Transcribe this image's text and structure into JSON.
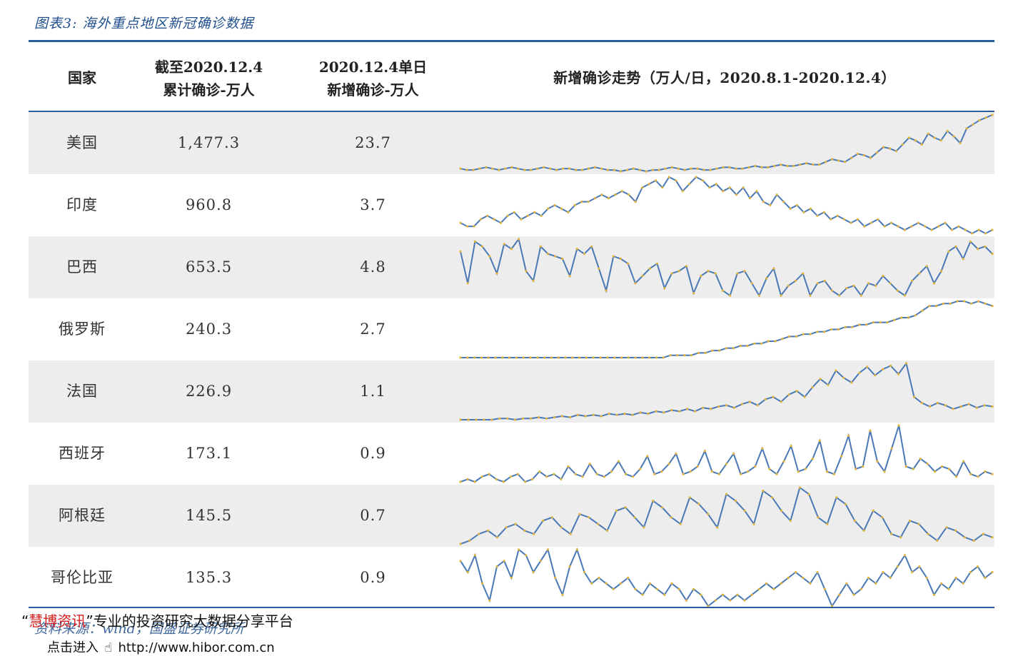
{
  "title": "图表3:  海外重点地区新冠确诊数据",
  "headers": {
    "country": "国家",
    "cumulative_line1": "截至2020.12.4",
    "cumulative_line2": "累计确诊-万人",
    "daily_line1": "2020.12.4单日",
    "daily_line2": "新增确诊-万人",
    "trend": "新增确诊走势（万人/日，2020.8.1-2020.12.4）"
  },
  "rows": [
    {
      "country": "美国",
      "cumulative": "1,477.3",
      "daily": "23.7"
    },
    {
      "country": "印度",
      "cumulative": "960.8",
      "daily": "3.7"
    },
    {
      "country": "巴西",
      "cumulative": "653.5",
      "daily": "4.8"
    },
    {
      "country": "俄罗斯",
      "cumulative": "240.3",
      "daily": "2.7"
    },
    {
      "country": "法国",
      "cumulative": "226.9",
      "daily": "1.1"
    },
    {
      "country": "西班牙",
      "cumulative": "173.1",
      "daily": "0.9"
    },
    {
      "country": "阿根廷",
      "cumulative": "145.5",
      "daily": "0.7"
    },
    {
      "country": "哥伦比亚",
      "cumulative": "135.3",
      "daily": "0.9"
    }
  ],
  "trend_colors": {
    "line": "#4a78b5",
    "marker": "#e0b43a"
  },
  "chart_data": {
    "type": "line",
    "x_range": [
      "2020.8.1",
      "2020.12.4"
    ],
    "note_units": "万人/日",
    "series": [
      {
        "name": "美国",
        "values": [
          0.2,
          0.1,
          0.1,
          0.2,
          0.3,
          0.2,
          0.1,
          0.2,
          0.3,
          0.2,
          0.1,
          0.1,
          0.2,
          0.3,
          0.2,
          0.1,
          0.2,
          0.2,
          0.1,
          0.1,
          0.2,
          0.3,
          0.2,
          0.1,
          0.1,
          0.0,
          0.1,
          0.2,
          0.1,
          0.0,
          0.1,
          0.1,
          0.2,
          0.3,
          0.2,
          0.1,
          0.2,
          0.2,
          0.1,
          0.1,
          0.2,
          0.3,
          0.3,
          0.2,
          0.2,
          0.3,
          0.4,
          0.3,
          0.3,
          0.4,
          0.5,
          0.4,
          0.4,
          0.5,
          0.6,
          0.5,
          0.5,
          0.7,
          0.9,
          0.8,
          0.7,
          1.0,
          1.3,
          1.2,
          1.0,
          1.4,
          1.8,
          1.7,
          1.5,
          2.0,
          2.5,
          2.3,
          2.0,
          2.8,
          2.5,
          2.3,
          3.0,
          2.6,
          2.1,
          3.2,
          3.5,
          3.8,
          4.0,
          4.2
        ]
      },
      {
        "name": "印度",
        "values": [
          0.4,
          0.3,
          0.3,
          0.5,
          0.6,
          0.5,
          0.4,
          0.6,
          0.7,
          0.5,
          0.6,
          0.7,
          0.6,
          0.8,
          0.9,
          0.8,
          0.7,
          0.9,
          1.0,
          1.0,
          1.1,
          1.2,
          1.1,
          1.2,
          1.3,
          1.2,
          1.0,
          1.4,
          1.5,
          1.6,
          1.4,
          1.7,
          1.6,
          1.3,
          1.5,
          1.7,
          1.6,
          1.4,
          1.5,
          1.3,
          1.4,
          1.2,
          1.4,
          1.1,
          1.3,
          1.0,
          0.9,
          1.2,
          1.0,
          0.8,
          0.9,
          0.7,
          0.8,
          0.6,
          0.7,
          0.5,
          0.6,
          0.5,
          0.4,
          0.5,
          0.3,
          0.4,
          0.5,
          0.3,
          0.4,
          0.3,
          0.2,
          0.3,
          0.4,
          0.3,
          0.2,
          0.3,
          0.4,
          0.2,
          0.3,
          0.2,
          0.1,
          0.2,
          0.1,
          0.2
        ]
      },
      {
        "name": "巴西",
        "values": [
          4.8,
          3.5,
          5.2,
          5.0,
          4.6,
          3.9,
          5.1,
          4.9,
          5.3,
          4.0,
          3.6,
          5.0,
          4.7,
          4.6,
          4.5,
          3.8,
          4.9,
          4.7,
          5.0,
          4.1,
          3.2,
          4.6,
          4.5,
          4.3,
          3.5,
          3.8,
          4.1,
          4.3,
          3.3,
          3.9,
          4.0,
          4.2,
          3.1,
          3.8,
          4.0,
          3.9,
          3.2,
          3.0,
          3.9,
          4.0,
          3.5,
          3.0,
          3.7,
          4.1,
          3.0,
          3.4,
          3.6,
          3.9,
          3.0,
          3.5,
          3.6,
          3.2,
          3.0,
          3.3,
          3.4,
          3.0,
          3.5,
          3.4,
          3.8,
          3.5,
          3.2,
          3.0,
          3.6,
          3.9,
          4.2,
          3.5,
          4.0,
          4.8,
          5.0,
          4.5,
          5.2,
          4.9,
          5.0,
          4.7
        ]
      },
      {
        "name": "俄罗斯",
        "values": [
          0.5,
          0.5,
          0.5,
          0.5,
          0.5,
          0.5,
          0.5,
          0.5,
          0.5,
          0.5,
          0.5,
          0.5,
          0.5,
          0.5,
          0.5,
          0.5,
          0.5,
          0.5,
          0.5,
          0.5,
          0.5,
          0.5,
          0.5,
          0.5,
          0.5,
          0.5,
          0.5,
          0.5,
          0.5,
          0.5,
          0.6,
          0.6,
          0.6,
          0.6,
          0.7,
          0.7,
          0.8,
          0.8,
          0.9,
          0.9,
          1.0,
          1.0,
          1.1,
          1.1,
          1.2,
          1.2,
          1.3,
          1.4,
          1.4,
          1.5,
          1.5,
          1.6,
          1.6,
          1.7,
          1.7,
          1.8,
          1.8,
          1.9,
          1.9,
          2.0,
          2.0,
          2.0,
          2.1,
          2.2,
          2.2,
          2.3,
          2.5,
          2.7,
          2.7,
          2.8,
          2.8,
          2.9,
          2.9,
          2.8,
          2.9,
          2.8,
          2.7
        ]
      },
      {
        "name": "法国",
        "values": [
          0.1,
          0.1,
          0.1,
          0.1,
          0.1,
          0.2,
          0.2,
          0.1,
          0.2,
          0.2,
          0.3,
          0.2,
          0.3,
          0.4,
          0.3,
          0.5,
          0.4,
          0.5,
          0.4,
          0.6,
          0.5,
          0.6,
          0.5,
          0.7,
          0.6,
          0.8,
          0.7,
          0.9,
          0.8,
          1.0,
          0.8,
          1.1,
          1.0,
          1.2,
          1.3,
          1.1,
          1.4,
          1.6,
          1.3,
          1.8,
          2.0,
          1.6,
          2.2,
          2.5,
          2.0,
          2.8,
          3.5,
          3.0,
          4.2,
          3.6,
          3.2,
          4.0,
          4.5,
          3.8,
          4.3,
          4.6,
          3.9,
          4.8,
          2.0,
          1.5,
          1.2,
          1.5,
          1.3,
          1.0,
          1.2,
          1.4,
          1.1,
          1.3,
          1.2
        ]
      },
      {
        "name": "西班牙",
        "values": [
          0.2,
          0.3,
          0.2,
          0.4,
          0.5,
          0.3,
          0.2,
          0.4,
          0.5,
          0.2,
          0.3,
          0.6,
          0.4,
          0.5,
          0.3,
          0.8,
          0.5,
          0.4,
          0.9,
          0.5,
          0.4,
          0.6,
          1.0,
          0.5,
          0.4,
          0.7,
          1.2,
          0.5,
          0.6,
          0.9,
          1.3,
          0.5,
          0.6,
          0.8,
          1.4,
          0.6,
          0.5,
          0.9,
          1.3,
          0.5,
          0.6,
          0.8,
          1.5,
          0.7,
          0.5,
          1.0,
          1.6,
          0.6,
          0.7,
          1.1,
          1.8,
          0.6,
          0.5,
          1.2,
          2.0,
          0.7,
          0.8,
          2.2,
          1.0,
          0.6,
          1.5,
          2.4,
          0.8,
          0.7,
          1.1,
          0.9,
          0.6,
          0.8,
          0.7,
          0.4,
          1.0,
          0.5,
          0.4,
          0.6,
          0.5
        ]
      },
      {
        "name": "阿根廷",
        "values": [
          0.2,
          0.3,
          0.5,
          0.6,
          0.4,
          0.7,
          0.8,
          0.6,
          0.5,
          0.9,
          1.0,
          0.7,
          0.5,
          1.1,
          1.0,
          0.8,
          0.6,
          1.2,
          1.3,
          1.0,
          0.7,
          1.5,
          1.3,
          1.0,
          0.8,
          1.6,
          1.4,
          1.1,
          0.7,
          1.7,
          1.5,
          1.2,
          0.8,
          1.8,
          1.6,
          1.2,
          0.9,
          1.9,
          1.7,
          1.0,
          0.8,
          1.6,
          1.4,
          0.9,
          0.6,
          1.2,
          1.0,
          0.5,
          0.4,
          0.9,
          0.8,
          0.5,
          0.3,
          0.7,
          0.6,
          0.4,
          0.3,
          0.5,
          0.4
        ]
      },
      {
        "name": "哥伦比亚",
        "values": [
          1.0,
          0.8,
          1.1,
          0.6,
          0.3,
          0.9,
          1.0,
          0.7,
          1.2,
          1.1,
          0.8,
          1.0,
          1.2,
          0.7,
          0.4,
          0.9,
          1.2,
          0.8,
          0.6,
          0.7,
          0.6,
          0.5,
          0.6,
          0.7,
          0.5,
          0.4,
          0.6,
          0.5,
          0.4,
          0.6,
          0.5,
          0.3,
          0.5,
          0.4,
          0.2,
          0.3,
          0.4,
          0.3,
          0.4,
          0.3,
          0.4,
          0.5,
          0.6,
          0.5,
          0.6,
          0.7,
          0.8,
          0.7,
          0.6,
          0.8,
          0.5,
          0.2,
          0.4,
          0.6,
          0.4,
          0.5,
          0.7,
          0.6,
          0.8,
          0.7,
          0.9,
          1.1,
          0.8,
          0.9,
          0.7,
          0.4,
          0.6,
          0.5,
          0.7,
          0.6,
          0.8,
          0.9,
          0.7,
          0.8
        ]
      }
    ]
  },
  "watermark": {
    "open_quote": "“",
    "brand": "慧博资讯",
    "close_quote": "”",
    "text": "专业的投资研究大数据分享平台"
  },
  "source": "资料来源：wind，国盛证券研究所",
  "link": {
    "prefix": "点击进入",
    "icon": "hand-pointer-icon",
    "url": "http://www.hibor.com.cn"
  }
}
